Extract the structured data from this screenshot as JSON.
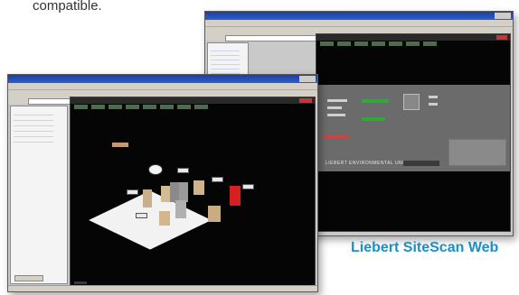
{
  "caption": "compatible.",
  "product_label": "Liebert SiteScan Web",
  "back_window": {
    "panel_label": "LIEBERT ENVIRONMENTAL UNIT"
  },
  "colors": {
    "brand": "#1a8fc8",
    "titlebar": "#2d5fd0",
    "status_green": "#2faa3a",
    "alarm_red": "#d42020"
  }
}
